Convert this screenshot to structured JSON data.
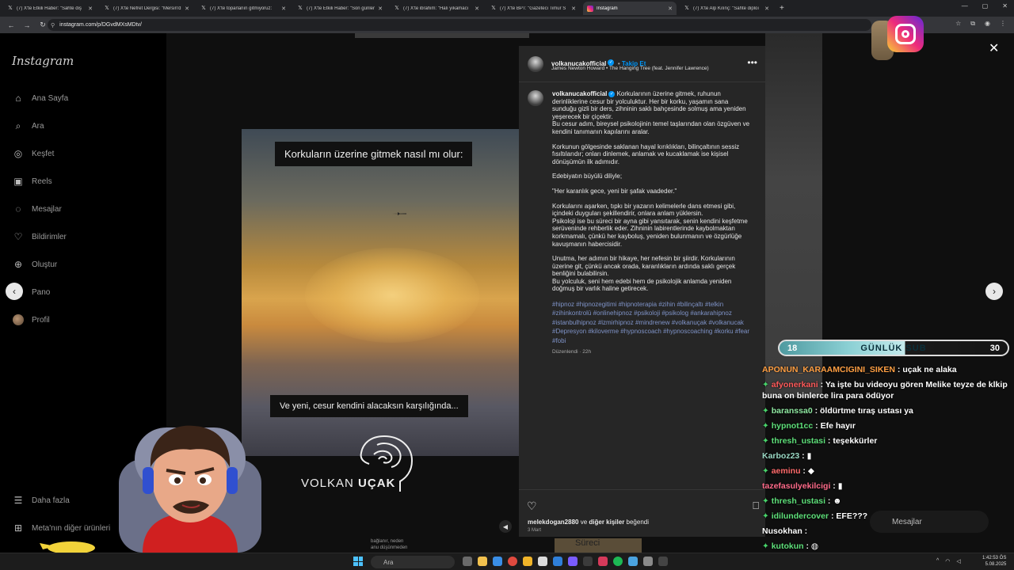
{
  "browser": {
    "tabs": [
      {
        "label": "(7) X'te Etkili Haber: \"Sahte diş",
        "active": false
      },
      {
        "label": "(7) X'te Nefret Dergisi: \"Mersin'd",
        "active": false
      },
      {
        "label": "(7) X'te toparlanın gitmiyoruz: ",
        "active": false
      },
      {
        "label": "(7) X'te Etkili Haber: \"Son günler",
        "active": false
      },
      {
        "label": "(7) X'te ibrahim: \"Halı yıkamacı",
        "active": false
      },
      {
        "label": "(7) X'te BPT: \"Gazeteci Timur S",
        "active": false
      },
      {
        "label": "Instagram",
        "active": true
      },
      {
        "label": "(7) X'te Alp Kılınç: \"Sahte diploı",
        "active": false
      }
    ],
    "new_tab": "+",
    "url": "instagram.com/p/DGvdMXsMDtv/"
  },
  "sidebar": {
    "logo": "Instagram",
    "items": [
      {
        "label": "Ana Sayfa",
        "icon": "home-icon",
        "glyph": "⌂"
      },
      {
        "label": "Ara",
        "icon": "search-icon",
        "glyph": "⌕"
      },
      {
        "label": "Keşfet",
        "icon": "compass-icon",
        "glyph": "◎"
      },
      {
        "label": "Reels",
        "icon": "reels-icon",
        "glyph": "▣"
      },
      {
        "label": "Mesajlar",
        "icon": "messenger-icon",
        "glyph": "◌"
      },
      {
        "label": "Bildirimler",
        "icon": "heart-icon",
        "glyph": "♡"
      },
      {
        "label": "Oluştur",
        "icon": "plus-icon",
        "glyph": "⊕"
      },
      {
        "label": "Pano",
        "icon": "dashboard-icon",
        "glyph": "▤"
      },
      {
        "label": "Profil",
        "icon": "avatar-icon",
        "glyph": ""
      }
    ],
    "more": "Daha fazla",
    "meta": "Meta'nın diğer ürünleri"
  },
  "media": {
    "caption_top": "Korkuların üzerine gitmek nasıl mı olur:",
    "caption_bottom": "Ve yeni, cesur kendini alacaksın karşılığında...",
    "brand_first": "VOLKAN ",
    "brand_second": "UÇAK",
    "below_left_1": "bağlanır, neden",
    "below_left_2": "anu düşünmeden",
    "below_right": "Süreci"
  },
  "post": {
    "username": "volkanucakofficial",
    "follow": "Takip Et",
    "song": "James Newton Howard • The Hanging Tree (feat. Jennifer Lawrence)",
    "caption_user": "volkanucakofficial",
    "caption_first": "Korkularının üzerine gitmek, ruhunun derinliklerine cesur bir yolculuktur. Her bir korku, yaşamın sana sunduğu gizli bir ders, zihninin saklı bahçesinde solmuş ama yeniden yeşerecek bir çiçektir.",
    "p1b": "Bu cesur adım, bireysel psikolojinin temel taşlarından olan özgüven ve kendini tanımanın kapılarını aralar.",
    "p2": "Korkunun gölgesinde saklanan hayal kırıklıkları, bilinçaltının sessiz fısıltılarıdır; onları dinlemek, anlamak ve kucaklamak ise kişisel dönüşümün ilk adımıdır.",
    "p3": "Edebiyatın büyülü diliyle;",
    "p4": "\"Her karanlık gece, yeni bir şafak vaadeder.\"",
    "p5a": "Korkularını aşarken, tıpkı bir yazarın kelimelerle dans etmesi gibi, içindeki duyguları şekillendirir, onlara anlam yüklersin.",
    "p5b": "Psikoloji ise bu süreci bir ayna gibi yansıtarak, senin kendini keşfetme serüveninde rehberlik eder. Zihninin labirentlerinde kaybolmaktan korkmamalı, çünkü her kayboluş, yeniden bulunmanın ve özgürlüğe kavuşmanın habercisidir.",
    "p6a": "Unutma, her adımın bir hikaye, her nefesin bir şiirdir. Korkularının üzerine git, çünkü ancak orada, karanlıkların ardında saklı gerçek benliğini bulabilirsin.",
    "p6b": "Bu yolculuk, seni hem edebi hem de psikolojik anlamda yeniden doğmuş bir varlık haline getirecek.",
    "hashtags": "#hipnoz #hipnozegitimi #hipnoterapia #zihin #bilinçaltı #telkin #zihinkontrolü #onlinehipnoz #psikoloji #psikolog #ankarahipnoz #istanbulhipnoz #izmirhipnoz #mindrenew #volkanuçak #volkanucak #Depresyon #kiloverme #hypnoscoach #hypnoscoaching #korku #fear #fobi",
    "edited": "Düzenlendi · 22h",
    "likes_user": "melekdogan2880",
    "likes_mid": " ve ",
    "likes_others": "diğer kişiler",
    "likes_end": " beğendi",
    "date": "3 Mart"
  },
  "overlay": {
    "sub_left": "18",
    "sub_mid": "GÜNLÜK SUB",
    "sub_right": "30",
    "sub_progress": 0.55,
    "message_placeholder": "Mesajlar",
    "chat": [
      {
        "user": "APONUN_KARAAMCIGINI_SIKEN",
        "text": " : uçak ne alaka",
        "color": "#ff9f43"
      },
      {
        "user": "afyonerkani",
        "text": " : Ya işte bu videoyu gören Melike teyze de klkip buna on binlerce lira para ödüyor",
        "color": "#ff5a5a"
      },
      {
        "user": "baranssa0",
        "text": " : öldürtme tıraş ustası ya",
        "color": "#8ee6a0"
      },
      {
        "user": "hypnot1cc",
        "text": " : Efe hayır",
        "color": "#5ee07a"
      },
      {
        "user": "thresh_ustasi",
        "text": " : teşekkürler",
        "color": "#5ee07a"
      },
      {
        "user": "Karboz23",
        "text": " : ▮",
        "color": "#9ad8c4"
      },
      {
        "user": "aeminu",
        "text": " : ◆",
        "color": "#ff6b6b"
      },
      {
        "user": "tazefasulyekilcigi",
        "text": " : ▮",
        "color": "#ff6b8a"
      },
      {
        "user": "thresh_ustasi",
        "text": " : ☻",
        "color": "#5ee07a"
      },
      {
        "user": "idilundercover",
        "text": " : EFE???",
        "color": "#5ee07a"
      },
      {
        "user": "Nusokhan",
        "text": " :",
        "color": "#ffffff"
      },
      {
        "user": "kutokun",
        "text": " : ◍",
        "color": "#5ee07a"
      }
    ]
  },
  "taskbar": {
    "search": "Ara",
    "time": "1:42:53 ÖS",
    "date": "5.08.2025"
  },
  "colors": {
    "accent": "#0095f6",
    "hashtag": "#7f93c8",
    "panel": "#262626"
  }
}
